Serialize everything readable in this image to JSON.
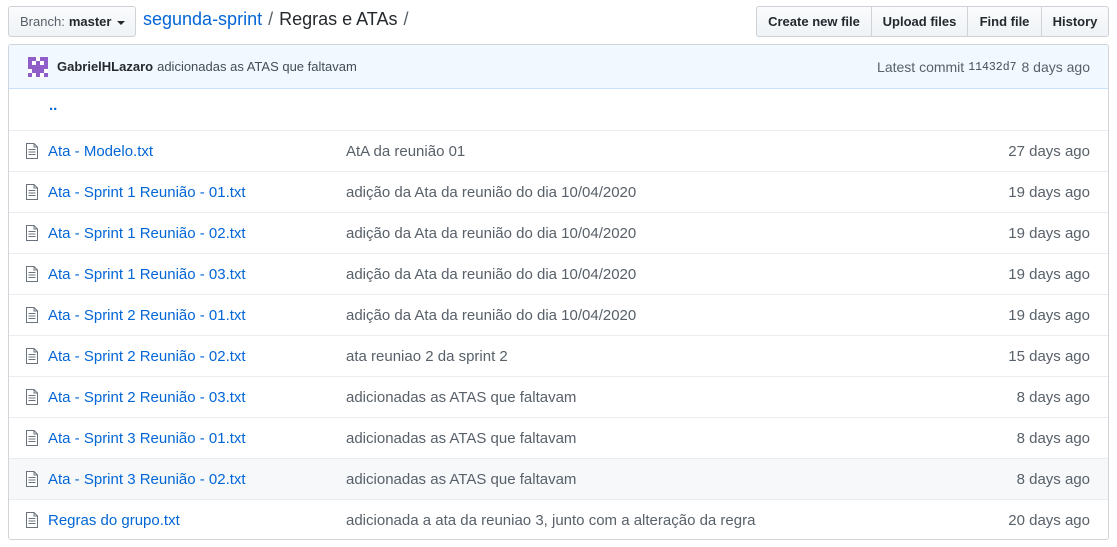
{
  "toolbar": {
    "branch_label": "Branch:",
    "branch_name": "master",
    "repo": "segunda-sprint",
    "separator1": "/",
    "folder": "Regras e ATAs",
    "separator2": "/",
    "create_new_file": "Create new file",
    "upload_files": "Upload files",
    "find_file": "Find file",
    "history": "History"
  },
  "commit": {
    "author": "GabrielHLazaro",
    "message": "adicionadas as ATAS que faltavam",
    "latest_label": "Latest commit",
    "sha": "11432d7",
    "age": "8 days ago"
  },
  "parent_link": "..",
  "files": [
    {
      "name": "Ata - Modelo.txt",
      "message": "AtA da reunião 01",
      "age": "27 days ago"
    },
    {
      "name": "Ata - Sprint 1 Reunião - 01.txt",
      "message": "adição da Ata da reunião do dia 10/04/2020",
      "age": "19 days ago"
    },
    {
      "name": "Ata - Sprint 1 Reunião - 02.txt",
      "message": "adição da Ata da reunião do dia 10/04/2020",
      "age": "19 days ago"
    },
    {
      "name": "Ata - Sprint 1 Reunião - 03.txt",
      "message": "adição da Ata da reunião do dia 10/04/2020",
      "age": "19 days ago"
    },
    {
      "name": "Ata - Sprint 2 Reunião - 01.txt",
      "message": "adição da Ata da reunião do dia 10/04/2020",
      "age": "19 days ago"
    },
    {
      "name": "Ata - Sprint 2 Reunião - 02.txt",
      "message": "ata reuniao 2 da sprint 2",
      "age": "15 days ago"
    },
    {
      "name": "Ata - Sprint 2 Reunião - 03.txt",
      "message": "adicionadas as ATAS que faltavam",
      "age": "8 days ago"
    },
    {
      "name": "Ata - Sprint 3 Reunião - 01.txt",
      "message": "adicionadas as ATAS que faltavam",
      "age": "8 days ago"
    },
    {
      "name": "Ata - Sprint 3 Reunião - 02.txt",
      "message": "adicionadas as ATAS que faltavam",
      "age": "8 days ago"
    },
    {
      "name": "Regras do grupo.txt",
      "message": "adicionada a ata da reuniao 3, junto com a alteração da regra",
      "age": "20 days ago"
    }
  ],
  "icons": {
    "file": "file-text-icon",
    "avatar": "identicon-avatar",
    "caret": "caret-down-icon"
  },
  "colors": {
    "link": "#0366d6",
    "commit_bar_bg": "#f1f8ff",
    "avatar": "#8f5ec9"
  }
}
